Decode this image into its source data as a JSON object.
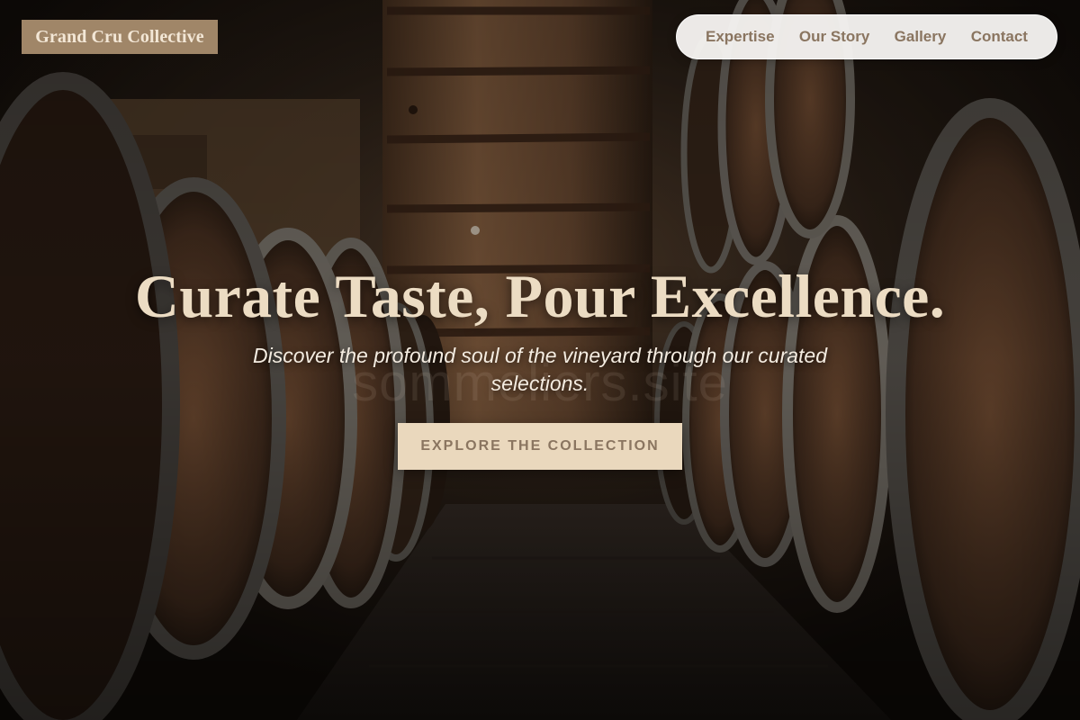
{
  "brand": {
    "logo_text": "Grand Cru Collective"
  },
  "nav": {
    "items": [
      {
        "label": "Expertise"
      },
      {
        "label": "Our Story"
      },
      {
        "label": "Gallery"
      },
      {
        "label": "Contact"
      }
    ]
  },
  "hero": {
    "title": "Curate Taste, Pour Excellence.",
    "subtitle": "Discover the profound soul of the vineyard through our curated selections.",
    "background_watermark": "sommeliers.site",
    "cta_label": "EXPLORE THE COLLECTION"
  },
  "colors": {
    "logo_bg": "#a08668",
    "logo_text": "#f3e7d6",
    "nav_bg": "#f5f3f0",
    "nav_text": "#8a7560",
    "title_text": "#ecdcc3",
    "cta_bg": "#ead8bd",
    "cta_text": "#8a7560"
  }
}
